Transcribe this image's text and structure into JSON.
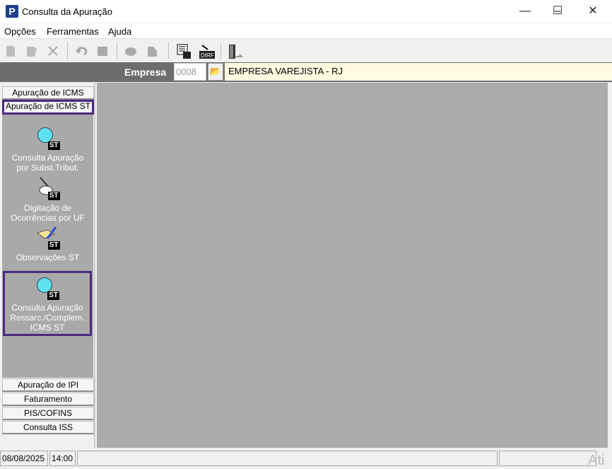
{
  "window": {
    "title": "Consulta da Apuração",
    "app_icon": "P"
  },
  "menu": [
    "Opções",
    "Ferramentas",
    "Ajuda"
  ],
  "toolbar": {
    "icons": [
      "new-icon",
      "edit-icon",
      "delete-icon",
      "undo-icon",
      "stop-icon",
      "print-icon",
      "print-preview-icon",
      "report-icon",
      "dirf-icon",
      "exit-icon"
    ],
    "dirf_label": "DIRF"
  },
  "empresa": {
    "label": "Empresa",
    "code": "0008",
    "name": "EMPRESA VAREJISTA - RJ"
  },
  "tabs_top": [
    "Apuração de ICMS",
    "Apuração de ICMS ST"
  ],
  "items": [
    {
      "line1": "Consulta  Apuração",
      "line2": "por Subst.Tribut.",
      "line3": ""
    },
    {
      "line1": "Digitação de",
      "line2": "Ocorrências por UF",
      "line3": ""
    },
    {
      "line1": "Observações ST",
      "line2": "",
      "line3": ""
    },
    {
      "line1": "Consulta Apuração",
      "line2": "Ressarc./Complem.",
      "line3": "ICMS ST"
    }
  ],
  "icon_badge": "ST",
  "tabs_bottom": [
    "Apuração de IPI",
    "Faturamento",
    "PIS/COFINS",
    "Consulta ISS"
  ],
  "status": {
    "date": "08/08/2025",
    "time": "14:00"
  },
  "watermark": "Ati",
  "colors": {
    "selection": "#4b2a84",
    "main_bg": "#ababab",
    "empresa_bar": "#6d6d6d",
    "empresa_name_bg": "#fffbe0"
  }
}
